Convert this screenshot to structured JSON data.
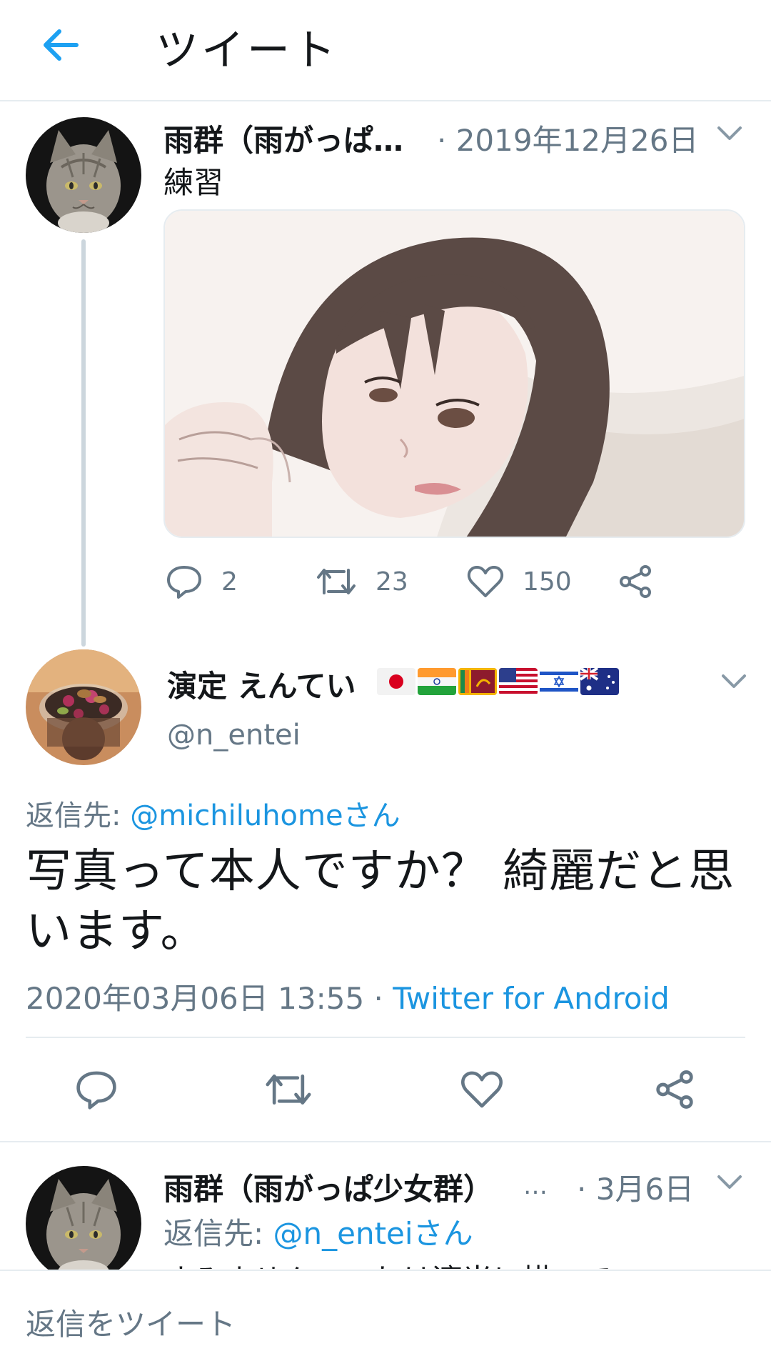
{
  "header": {
    "title": "ツイート",
    "back_icon": "arrow-left-icon"
  },
  "tweet1": {
    "name": "雨群（雨がっぱ…",
    "date": "· 2019年12月26日",
    "text": "練習",
    "reply_count": "2",
    "retweet_count": "23",
    "like_count": "150"
  },
  "tweet2": {
    "name": "演定 えんてい",
    "handle": "@n_entei",
    "flags": [
      "japan-flag-icon",
      "india-flag-icon",
      "sri-lanka-flag-icon",
      "usa-flag-icon",
      "israel-flag-icon",
      "australia-flag-icon"
    ],
    "reply_to_label": "返信先:",
    "reply_to_user": "@michiluhomeさん",
    "text": "写真って本人ですか？ 綺麗だと思います。",
    "timestamp": "2020年03月06日 13:55 · ",
    "source": "Twitter for Android"
  },
  "tweet3": {
    "name": "雨群（雨がっぱ少女群）",
    "ellipsis": "…",
    "date": "· 3月6日",
    "reply_to_label": "返信先:",
    "reply_to_user": "@n_enteiさん",
    "text_partial": "すみません、これは適当に描いて"
  },
  "reply_bar": {
    "placeholder": "返信をツイート"
  },
  "colors": {
    "accent": "#1da1f2",
    "link": "#1b95e0",
    "secondary_text": "#657786",
    "divider": "#e6ecf0"
  }
}
